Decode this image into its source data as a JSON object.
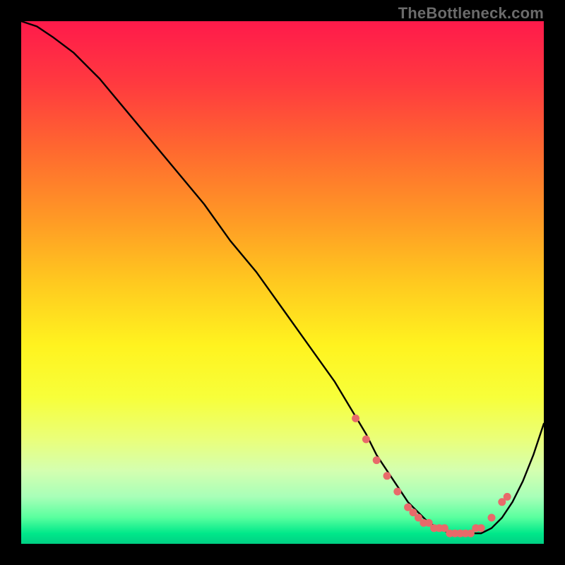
{
  "attribution": "TheBottleneck.com",
  "chart_data": {
    "type": "line",
    "title": "",
    "xlabel": "",
    "ylabel": "",
    "xlim": [
      0,
      100
    ],
    "ylim": [
      0,
      100
    ],
    "grid": false,
    "legend": false,
    "series": [
      {
        "name": "bottleneck-curve",
        "x": [
          0,
          3,
          6,
          10,
          15,
          20,
          25,
          30,
          35,
          40,
          45,
          50,
          55,
          60,
          63,
          66,
          68,
          70,
          72,
          74,
          76,
          78,
          80,
          82,
          84,
          86,
          88,
          90,
          92,
          94,
          96,
          98,
          100
        ],
        "y": [
          100,
          99,
          97,
          94,
          89,
          83,
          77,
          71,
          65,
          58,
          52,
          45,
          38,
          31,
          26,
          21,
          17,
          14,
          11,
          8,
          6,
          4,
          3,
          2,
          2,
          2,
          2,
          3,
          5,
          8,
          12,
          17,
          23
        ]
      }
    ],
    "markers": {
      "name": "optimal-range-dots",
      "x": [
        64,
        66,
        68,
        70,
        72,
        74,
        75,
        76,
        77,
        78,
        79,
        80,
        81,
        82,
        83,
        84,
        85,
        86,
        87,
        88,
        90,
        92,
        93
      ],
      "y": [
        24,
        20,
        16,
        13,
        10,
        7,
        6,
        5,
        4,
        4,
        3,
        3,
        3,
        2,
        2,
        2,
        2,
        2,
        3,
        3,
        5,
        8,
        9
      ]
    },
    "background_gradient": {
      "top": "#ff1a4b",
      "mid": "#fff31f",
      "bottom": "#00d084"
    }
  }
}
